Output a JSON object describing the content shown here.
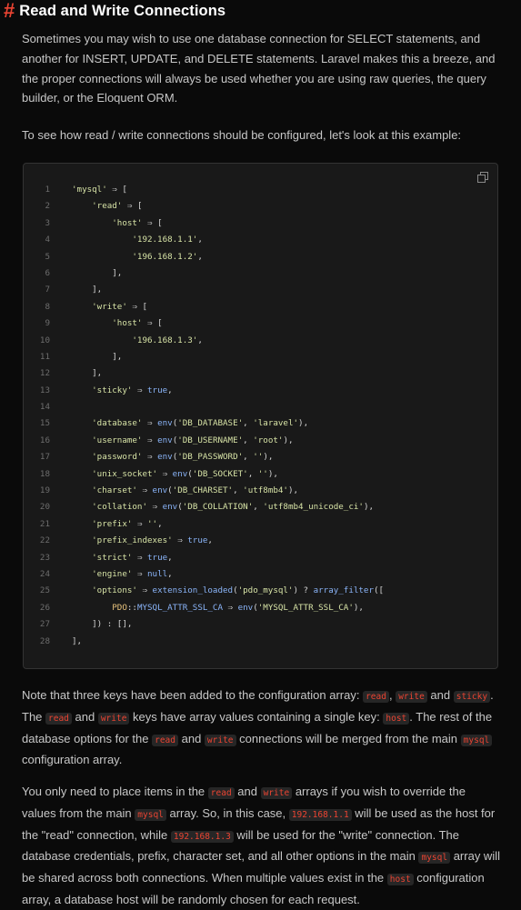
{
  "heading": {
    "hash": "#",
    "title": "Read and Write Connections"
  },
  "para1": "Sometimes you may wish to use one database connection for SELECT statements, and another for INSERT, UPDATE, and DELETE statements. Laravel makes this a breeze, and the proper connections will always be used whether you are using raw queries, the query builder, or the Eloquent ORM.",
  "para2": "To see how read / write connections should be configured, let's look at this example:",
  "code": {
    "copy_icon": "copy-icon",
    "lines": [
      "'mysql' ⇒ [",
      "    'read' ⇒ [",
      "        'host' ⇒ [",
      "            '192.168.1.1',",
      "            '196.168.1.2',",
      "        ],",
      "    ],",
      "    'write' ⇒ [",
      "        'host' ⇒ [",
      "            '196.168.1.3',",
      "        ],",
      "    ],",
      "    'sticky' ⇒ true,",
      "",
      "    'database' ⇒ env('DB_DATABASE', 'laravel'),",
      "    'username' ⇒ env('DB_USERNAME', 'root'),",
      "    'password' ⇒ env('DB_PASSWORD', ''),",
      "    'unix_socket' ⇒ env('DB_SOCKET', ''),",
      "    'charset' ⇒ env('DB_CHARSET', 'utf8mb4'),",
      "    'collation' ⇒ env('DB_COLLATION', 'utf8mb4_unicode_ci'),",
      "    'prefix' ⇒ '',",
      "    'prefix_indexes' ⇒ true,",
      "    'strict' ⇒ true,",
      "    'engine' ⇒ null,",
      "    'options' ⇒ extension_loaded('pdo_mysql') ? array_filter([",
      "        PDO::MYSQL_ATTR_SSL_CA ⇒ env('MYSQL_ATTR_SSL_CA'),",
      "    ]) : [],",
      "],"
    ]
  },
  "para3": {
    "t1": "Note that three keys have been added to the configuration array: ",
    "c1": "read",
    "t2": ", ",
    "c2": "write",
    "t3": " and ",
    "c3": "sticky",
    "t4": ". The ",
    "c4": "read",
    "t5": " and ",
    "c5": "write",
    "t6": " keys have array values containing a single key: ",
    "c6": "host",
    "t7": ". The rest of the database options for the ",
    "c7": "read",
    "t8": " and ",
    "c8": "write",
    "t9": " connections will be merged from the main ",
    "c9": "mysql",
    "t10": " configuration array."
  },
  "para4": {
    "t1": "You only need to place items in the ",
    "c1": "read",
    "t2": " and ",
    "c2": "write",
    "t3": " arrays if you wish to override the values from the main ",
    "c3": "mysql",
    "t4": " array. So, in this case, ",
    "c4": "192.168.1.1",
    "t5": " will be used as the host for the \"read\" connection, while ",
    "c5": "192.168.1.3",
    "t6": " will be used for the \"write\" connection. The database credentials, prefix, character set, and all other options in the main ",
    "c6": "mysql",
    "t7": " array will be shared across both connections. When multiple values exist in the ",
    "c7": "host",
    "t8": " configuration array, a database host will be randomly chosen for each request."
  }
}
